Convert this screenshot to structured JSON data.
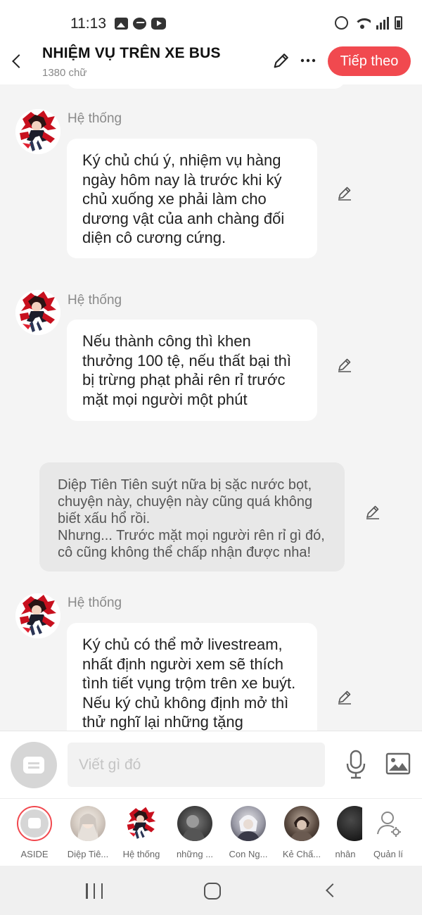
{
  "status_bar": {
    "time": "11:13"
  },
  "header": {
    "title": "NHIỆM VỤ TRÊN XE BUS",
    "subtitle": "1380 chữ",
    "next_label": "Tiếp theo"
  },
  "messages": [
    {
      "sender": "Hệ thống",
      "text": "Ký chủ chú ý, nhiệm vụ hàng ngày hôm nay là trước khi ký chủ xuống xe phải làm cho dương vật của anh chàng đối diện cô cương cứng."
    },
    {
      "sender": "Hệ thống",
      "text": "Nếu thành công thì khen thưởng 100 tệ, nếu thất bại thì bị trừng phạt phải rên rỉ trước mặt mọi người một phút"
    },
    {
      "narration": "Diệp Tiên Tiên suýt nữa bị sặc nước bọt, chuyện này, chuyện này cũng quá không biết xấu hổ rồi.\nNhưng... Trước mặt mọi người rên rỉ gì đó, cô cũng không thể chấp nhận được nha!"
    },
    {
      "sender": "Hệ thống",
      "text": "Ký chủ có thể mở livestream, nhất định người xem sẽ thích tình tiết vụng trộm trên xe buýt. Nếu ký chủ không định mở thì thử nghĩ lại những tặng"
    }
  ],
  "input": {
    "placeholder": "Viết gì đó"
  },
  "characters": [
    {
      "label": "ASIDE"
    },
    {
      "label": "Diệp Tiê..."
    },
    {
      "label": "Hệ thống"
    },
    {
      "label": "những ..."
    },
    {
      "label": "Con Ng..."
    },
    {
      "label": "Kẻ Chấ..."
    },
    {
      "label": "nhân"
    },
    {
      "label": "Quản lí"
    }
  ],
  "colors": {
    "accent": "#f1494f",
    "background": "#f4f4f4"
  }
}
